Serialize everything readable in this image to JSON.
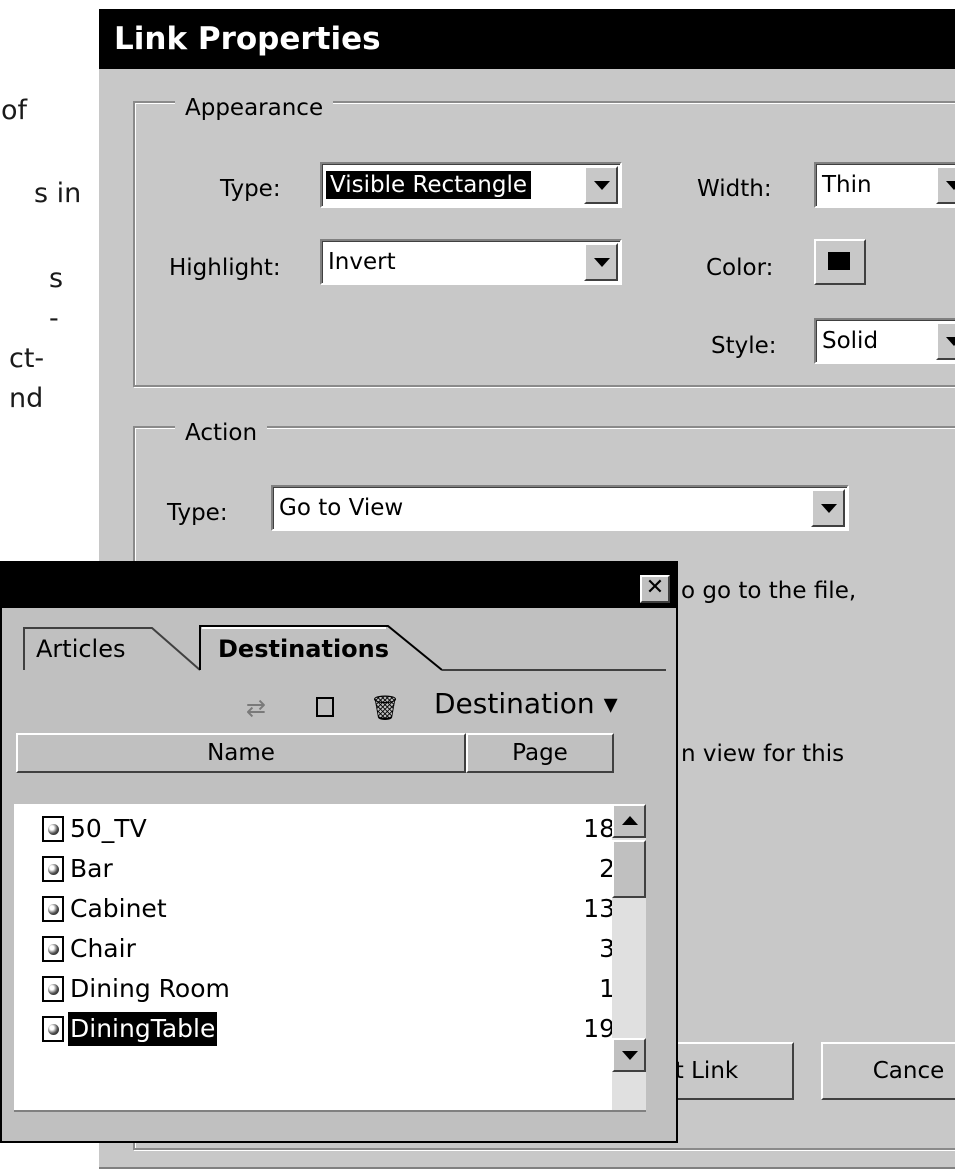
{
  "background_text": [
    "of",
    "s in",
    "s",
    "-",
    "ct-",
    "nd"
  ],
  "dialog": {
    "title": "Link Properties",
    "appearance": {
      "legend": "Appearance",
      "type_label": "Type:",
      "type_value": "Visible Rectangle",
      "highlight_label": "Highlight:",
      "highlight_value": "Invert",
      "width_label": "Width:",
      "width_value": "Thin",
      "color_label": "Color:",
      "color_value": "#000000",
      "style_label": "Style:",
      "style_value": "Solid"
    },
    "action": {
      "legend": "Action",
      "type_label": "Type:",
      "type_value": "Go to View",
      "text1": "o go to the file,",
      "text2": "n view for this"
    },
    "buttons": {
      "set_link": "t Link",
      "cancel": "Cance"
    }
  },
  "palette": {
    "tabs": [
      "Articles",
      "Destinations"
    ],
    "toolbar": {
      "icons": [
        "refresh-icon",
        "new-destination-icon",
        "trash-icon"
      ],
      "menu_label": "Destination ▾"
    },
    "columns": [
      "Name",
      "Page"
    ],
    "rows": [
      {
        "name": "50_TV",
        "page": "18"
      },
      {
        "name": "Bar",
        "page": "2"
      },
      {
        "name": "Cabinet",
        "page": "13"
      },
      {
        "name": "Chair",
        "page": "3"
      },
      {
        "name": "Dining Room",
        "page": "1"
      },
      {
        "name": "DiningTable",
        "page": "19",
        "selected": true
      }
    ],
    "close_glyph": "✕"
  }
}
